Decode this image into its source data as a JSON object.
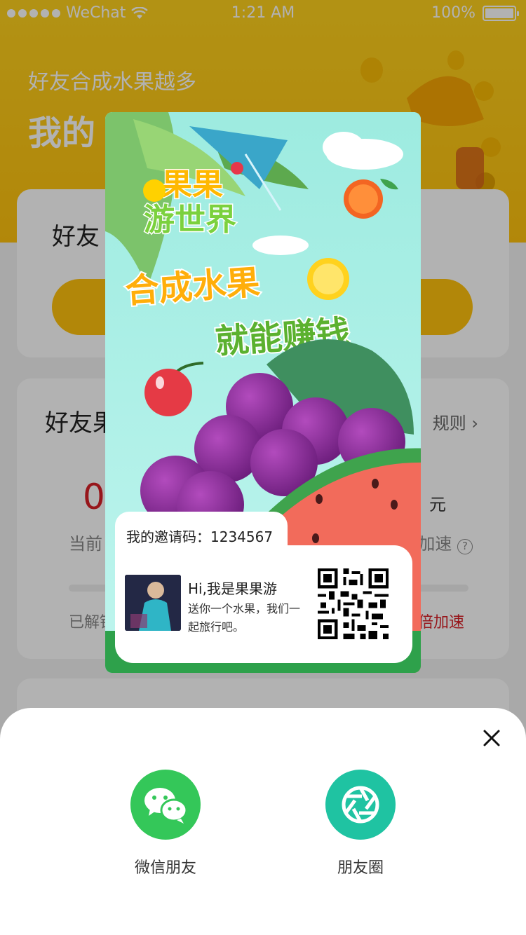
{
  "status_bar": {
    "carrier": "WeChat",
    "time": "1:21 AM",
    "battery": "100%"
  },
  "hero": {
    "subtitle": "好友合成水果越多",
    "title": "我的"
  },
  "card1": {
    "title": "好友"
  },
  "card2": {
    "title": "好友果",
    "rules_label": "规则",
    "left_value": "0",
    "right_unit": "元",
    "left_label": "当前",
    "right_label": "加速",
    "unlock_label": "已解锁",
    "speed_label": "倍加速"
  },
  "poster": {
    "logo_line1": "果果",
    "logo_line2": "游世界",
    "slogan1": "合成水果",
    "slogan2": "就能赚钱",
    "invite_code_label": "我的邀请码：",
    "invite_code": "1234567",
    "greeting": "Hi,我是果果游",
    "description": "送你一个水果，我们一起旅行吧。"
  },
  "share_sheet": {
    "options": [
      {
        "label": "微信朋友",
        "icon": "wechat-icon",
        "color": "#34c759"
      },
      {
        "label": "朋友圈",
        "icon": "moments-icon",
        "color": "#1fc3a2"
      }
    ]
  },
  "colors": {
    "brand_yellow": "#ffc20e",
    "accent_red": "#d92027"
  }
}
